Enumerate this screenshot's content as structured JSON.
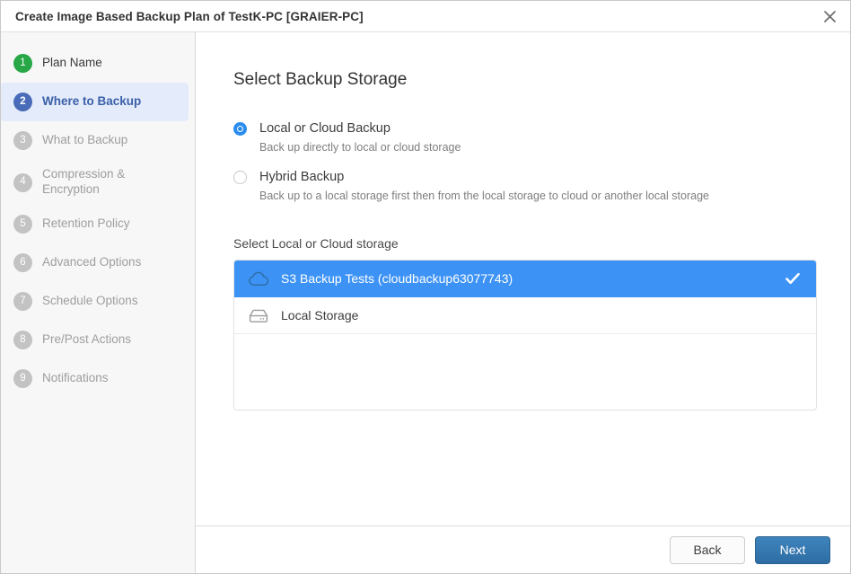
{
  "window": {
    "title": "Create Image Based Backup Plan of TestK-PC [GRAIER-PC]",
    "close_icon": "close-icon",
    "accent_blue": "#3d93f5",
    "active_step_blue": "#4a6cb8",
    "done_step_green": "#27a745",
    "primary_button_blue": "#2e6da4"
  },
  "sidebar": {
    "items": [
      {
        "number": "1",
        "label": "Plan Name",
        "state": "done"
      },
      {
        "number": "2",
        "label": "Where to Backup",
        "state": "active"
      },
      {
        "number": "3",
        "label": "What to Backup",
        "state": "pending"
      },
      {
        "number": "4",
        "label": "Compression & Encryption",
        "state": "pending"
      },
      {
        "number": "5",
        "label": "Retention Policy",
        "state": "pending"
      },
      {
        "number": "6",
        "label": "Advanced Options",
        "state": "pending"
      },
      {
        "number": "7",
        "label": "Schedule Options",
        "state": "pending"
      },
      {
        "number": "8",
        "label": "Pre/Post Actions",
        "state": "pending"
      },
      {
        "number": "9",
        "label": "Notifications",
        "state": "pending"
      }
    ]
  },
  "main": {
    "heading": "Select Backup Storage",
    "backup_mode_options": [
      {
        "label": "Local or Cloud Backup",
        "description": "Back up directly to local or cloud storage",
        "selected": true
      },
      {
        "label": "Hybrid Backup",
        "description": "Back up to a local storage first then from the local storage to cloud or another local storage",
        "selected": false
      }
    ],
    "storage_caption": "Select Local or Cloud storage",
    "storage_items": [
      {
        "label": "S3 Backup Tests (cloudbackup63077743)",
        "icon": "cloud-icon",
        "selected": true
      },
      {
        "label": "Local Storage",
        "icon": "hard-drive-icon",
        "selected": false
      }
    ]
  },
  "footer": {
    "back_label": "Back",
    "next_label": "Next"
  }
}
